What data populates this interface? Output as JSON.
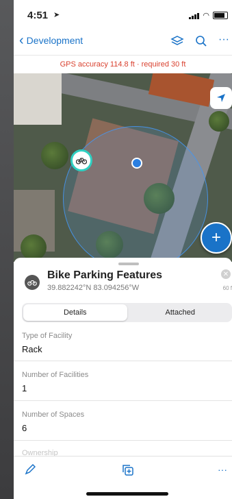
{
  "status": {
    "time": "4:51"
  },
  "nav": {
    "back_label": "Development"
  },
  "gps": {
    "text": "GPS accuracy 114.8 ft · required 30 ft"
  },
  "feature": {
    "title": "Bike Parking Features",
    "coordinates": "39.882242°N 83.094256°W",
    "distance": "60 f"
  },
  "tabs": [
    {
      "label": "Details"
    },
    {
      "label": "Attached"
    }
  ],
  "fields": [
    {
      "label": "Type of Facility",
      "value": "Rack"
    },
    {
      "label": "Number of Facilities",
      "value": "1"
    },
    {
      "label": "Number of Spaces",
      "value": "6"
    },
    {
      "label": "Ownership",
      "value": ""
    }
  ],
  "colors": {
    "accent": "#1a73c8",
    "warning": "#d9412f",
    "marker_ring": "#2fd0c2"
  }
}
